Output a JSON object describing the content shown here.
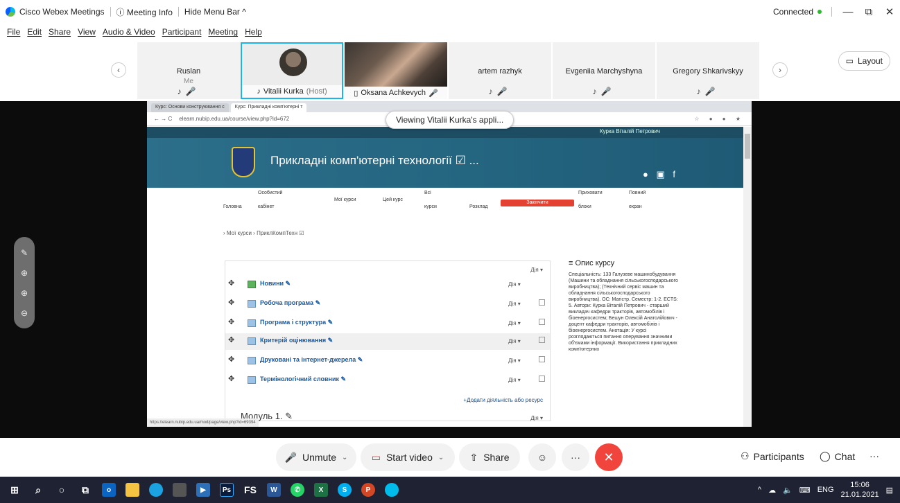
{
  "titlebar": {
    "app_name": "Cisco Webex Meetings",
    "meeting_info": "ⓘ Meeting Info",
    "hide_menu": "Hide Menu Bar ^",
    "status": "Connected",
    "min": "—",
    "restore": "⧉",
    "close": "✕"
  },
  "menu": [
    "File",
    "Edit",
    "Share",
    "View",
    "Audio & Video",
    "Participant",
    "Meeting",
    "Help"
  ],
  "participants": {
    "tiles": [
      {
        "name": "Ruslan",
        "sub": "Me"
      },
      {
        "name": "Vitalii Kurka",
        "role": "(Host)"
      },
      {
        "name": "Oksana Achkevych"
      },
      {
        "name": "artem razhyk"
      },
      {
        "name": "Evgeniia Marchyshyna"
      },
      {
        "name": "Gregory Shkarivskyy"
      }
    ],
    "prev": "‹",
    "next": "›",
    "layout_label": "Layout"
  },
  "shared": {
    "viewing_label": "Viewing Vitalii Kurka's appli...",
    "tabs": [
      "Курс: Основи конструювання с",
      "Курс: Прикладні комп'ютерні т"
    ],
    "url": "elearn.nubip.edu.ua/course/view.php?id=672",
    "user": "Курка Віталій Петрович",
    "course_title": "Прикладні комп'ютерні технології ☑ ...",
    "nav": {
      "home": "Головна",
      "cabinet_top": "Особистий",
      "cabinet_bottom": "кабінет",
      "my_courses": "Мої курси",
      "this_course": "Цей курс",
      "all_top": "Всі",
      "all_bottom": "курси",
      "schedule": "Розклад",
      "finish": "Закінчити",
      "hide_top": "Приховати",
      "hide_bottom": "блоки",
      "full_top": "Повний",
      "full_bottom": "екран"
    },
    "breadcrumb": "› Мої курси › ПриклКомпТехн ☑",
    "dia_header": "Дія ▾",
    "activities": [
      {
        "label": "Новини ✎",
        "dia": "Дія ▾"
      },
      {
        "label": "Робоча програма ✎",
        "dia": "Дія ▾"
      },
      {
        "label": "Програма і структура ✎",
        "dia": "Дія ▾"
      },
      {
        "label": "Критерій оцінювання ✎",
        "dia": "Дія ▾"
      },
      {
        "label": "Друковані та інтернет-джерела ✎",
        "dia": "Дія ▾"
      },
      {
        "label": "Термінологічний словник ✎",
        "dia": "Дія ▾"
      }
    ],
    "add_activity": "+Додати діяльність або ресурс",
    "module": "Модуль 1. ✎",
    "module_dia": "Дія ▾",
    "sidebar_title": "≡ Опис курсу",
    "sidebar_text": "Спеціальність: 133 Галузеве машинобудування (Машини та обладнання сільськогосподарського виробництва); (Технічний сервіс машин та обладнання сільськогосподарського виробництва). ОС: Магістр. Семестр: 1-2. ECTS: 5. Автори: Курка Віталій Петрович - старший викладач кафедри тракторів, автомобілів і біоенергосистем; Бешун Олексій Анатолійович - доцент кафедри тракторів, автомобілів і біоенергосистем. Анотація: У курсі розглядаються питання оперування значними об'ємами інформації. Використання прикладних комп'ютерних",
    "status_url": "https://elearn.nubip.edu.ua/mod/page/view.php?id=69394"
  },
  "controls": {
    "unmute": "Unmute",
    "start_video": "Start video",
    "share": "Share",
    "participants": "Participants",
    "chat": "Chat",
    "more": "···",
    "end": "✕"
  },
  "taskbar": {
    "lang": "ENG",
    "time": "15:06",
    "date": "21.01.2021"
  }
}
